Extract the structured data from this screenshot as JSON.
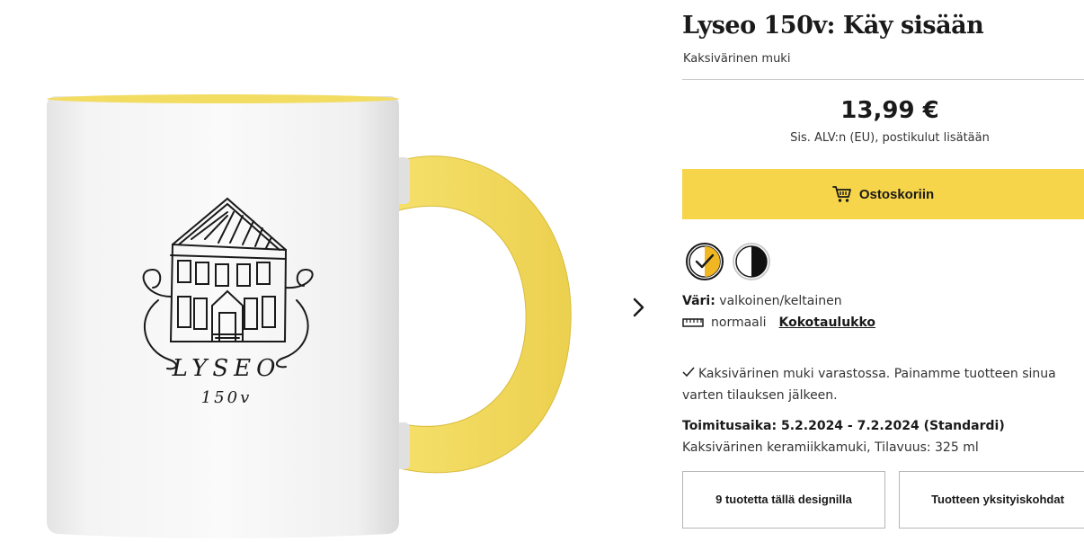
{
  "product": {
    "title": "Lyseo 150v: Käy sisään",
    "subtitle": "Kaksivärinen muki",
    "price": "13,99 €",
    "vat_note": "Sis. ALV:n (EU), postikulut lisätään",
    "add_to_cart_label": "Ostoskoriin",
    "color_label": "Väri:",
    "color_value": "valkoinen/keltainen",
    "size_value": "normaali",
    "size_chart_link": "Kokotaulukko",
    "stock_text": "Kaksivärinen muki varastossa. Painamme tuotteen sinua varten tilauksen jälkeen.",
    "delivery_text": "Toimitusaika: 5.2.2024 - 7.2.2024 (Standardi)",
    "material_text": "Kaksivärinen keramiikkamuki, Tilavuus: 325 ml",
    "more_products_button": "9 tuotetta tällä designilla",
    "details_button": "Tuotteen yksityiskohdat"
  },
  "design": {
    "name_text": "LYSEO",
    "number_text": "150v"
  },
  "swatches": [
    {
      "name": "white-yellow",
      "left_color": "#ffffff",
      "right_color": "#f0b722",
      "selected": true
    },
    {
      "name": "white-black",
      "left_color": "#ffffff",
      "right_color": "#111111",
      "selected": false
    }
  ],
  "icons": {
    "cart": "cart-icon",
    "ruler": "ruler-icon",
    "check": "check-icon",
    "next": "chevron-right-icon"
  },
  "colors": {
    "accent": "#f7d54a",
    "mug_handle": "#f3dc62",
    "text": "#1a1a1a"
  }
}
